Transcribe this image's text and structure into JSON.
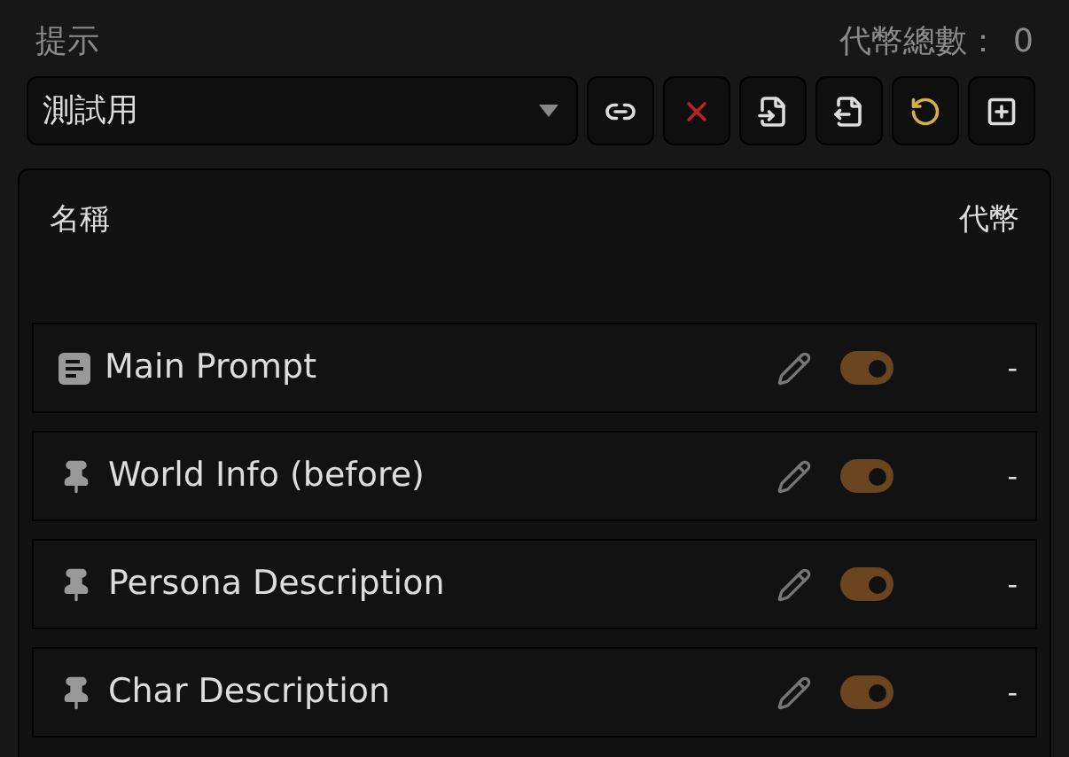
{
  "header": {
    "title": "提示",
    "token_total_label": "代幣總數：",
    "token_total": "0"
  },
  "preset": {
    "value": "測試用"
  },
  "toolbar": [
    {
      "kind": "link"
    },
    {
      "kind": "delete"
    },
    {
      "kind": "import"
    },
    {
      "kind": "export"
    },
    {
      "kind": "reset"
    },
    {
      "kind": "add"
    }
  ],
  "table": {
    "columns": [
      "名稱",
      "代幣"
    ],
    "rows": [
      {
        "kind": "system",
        "name": "Main Prompt",
        "enabled": true,
        "tokens": "-"
      },
      {
        "kind": "marker",
        "name": "World Info (before)",
        "enabled": true,
        "tokens": "-"
      },
      {
        "kind": "marker",
        "name": "Persona Description",
        "enabled": true,
        "tokens": "-"
      },
      {
        "kind": "marker",
        "name": "Char Description",
        "enabled": true,
        "tokens": "-"
      }
    ]
  }
}
